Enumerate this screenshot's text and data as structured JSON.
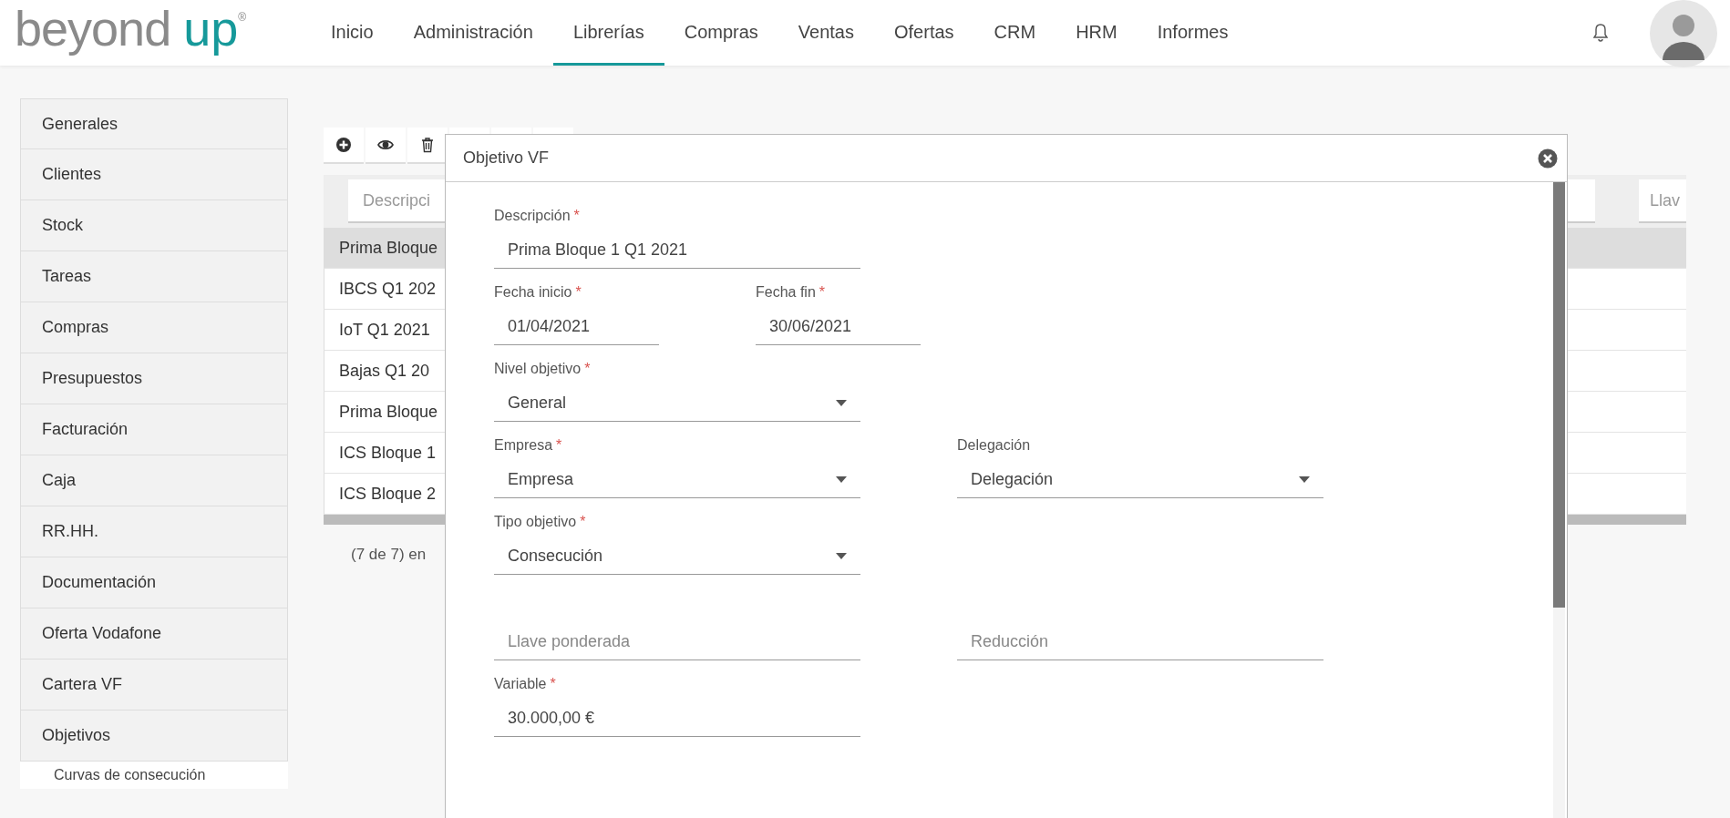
{
  "logo": {
    "word_1": "beyond",
    "word_2": "up",
    "mark": "®"
  },
  "nav": [
    {
      "label": "Inicio",
      "selected": false
    },
    {
      "label": "Administración",
      "selected": false
    },
    {
      "label": "Librerías",
      "selected": true
    },
    {
      "label": "Compras",
      "selected": false
    },
    {
      "label": "Ventas",
      "selected": false
    },
    {
      "label": "Ofertas",
      "selected": false
    },
    {
      "label": "CRM",
      "selected": false
    },
    {
      "label": "HRM",
      "selected": false
    },
    {
      "label": "Informes",
      "selected": false
    }
  ],
  "sidebar": {
    "items": [
      {
        "label": "Generales"
      },
      {
        "label": "Clientes"
      },
      {
        "label": "Stock"
      },
      {
        "label": "Tareas"
      },
      {
        "label": "Compras"
      },
      {
        "label": "Presupuestos"
      },
      {
        "label": "Facturación"
      },
      {
        "label": "Caja"
      },
      {
        "label": "RR.HH."
      },
      {
        "label": "Documentación"
      },
      {
        "label": "Oferta Vodafone"
      },
      {
        "label": "Cartera VF"
      },
      {
        "label": "Objetivos",
        "children": [
          {
            "label": "Curvas de consecución"
          }
        ]
      }
    ]
  },
  "table": {
    "filters": [
      {
        "placeholder": "Descripci"
      },
      {
        "placeholder": "Llav"
      }
    ],
    "rows": [
      {
        "column_1": "Prima Bloque",
        "selected": true
      },
      {
        "column_1": "IBCS Q1 202",
        "selected": false
      },
      {
        "column_1": "IoT Q1 2021",
        "selected": false
      },
      {
        "column_1": "Bajas Q1 20",
        "selected": false
      },
      {
        "column_1": "Prima Bloque",
        "selected": false
      },
      {
        "column_1": "ICS Bloque 1",
        "selected": false
      },
      {
        "column_1": "ICS Bloque 2",
        "selected": false
      }
    ],
    "footer": "(7 de 7) en"
  },
  "modal": {
    "title": "Objetivo VF",
    "rows": [
      {
        "fields": [
          {
            "kind": "text",
            "label": "Descripción",
            "required_mark": "*",
            "value": "Prima Bloque 1 Q1 2021"
          }
        ]
      },
      {
        "fields": [
          {
            "kind": "date",
            "label": "Fecha inicio",
            "required_mark": "*",
            "value": "01/04/2021"
          },
          {
            "kind": "date",
            "label": "Fecha fin",
            "required_mark": "*",
            "value": "30/06/2021"
          }
        ]
      },
      {
        "fields": [
          {
            "kind": "select",
            "label": "Nivel objetivo",
            "required_mark": "*",
            "value": "General"
          }
        ]
      },
      {
        "fields": [
          {
            "kind": "select",
            "label": "Empresa",
            "required_mark": "*",
            "value": "Empresa"
          },
          {
            "kind": "select",
            "label": "Delegación",
            "value": "Delegación"
          }
        ]
      },
      {
        "fields": [
          {
            "kind": "select",
            "label": "Tipo objetivo",
            "required_mark": "*",
            "value": "Consecución"
          }
        ]
      },
      {
        "fields": [
          {
            "kind": "text",
            "placeholder": "Llave ponderada"
          },
          {
            "kind": "text",
            "placeholder": "Reducción"
          }
        ]
      },
      {
        "fields": [
          {
            "kind": "text",
            "label": "Variable",
            "required_mark": "*",
            "value": "30.000,00 €"
          }
        ]
      }
    ]
  }
}
